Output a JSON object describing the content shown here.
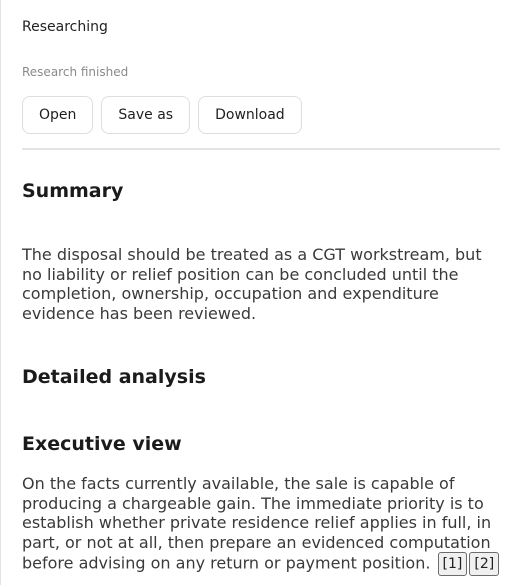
{
  "status": {
    "title": "Researching",
    "subtitle": "Research finished"
  },
  "actions": {
    "open_label": "Open",
    "save_as_label": "Save as",
    "download_label": "Download"
  },
  "report": {
    "summary_heading": "Summary",
    "summary_text": "The disposal should be treated as a CGT workstream, but no liability or relief position can be concluded until the completion, ownership, occupation and expenditure evidence has been reviewed.",
    "detailed_heading": "Detailed analysis",
    "executive_heading": "Executive view",
    "executive_text": "On the facts currently available, the sale is capable of producing a chargeable gain. The immediate priority is to establish whether private residence relief applies in full, in part, or not at all, then prepare an evidenced computation before advising on any return or payment position.",
    "citations": [
      "[1]",
      "[2]"
    ]
  }
}
